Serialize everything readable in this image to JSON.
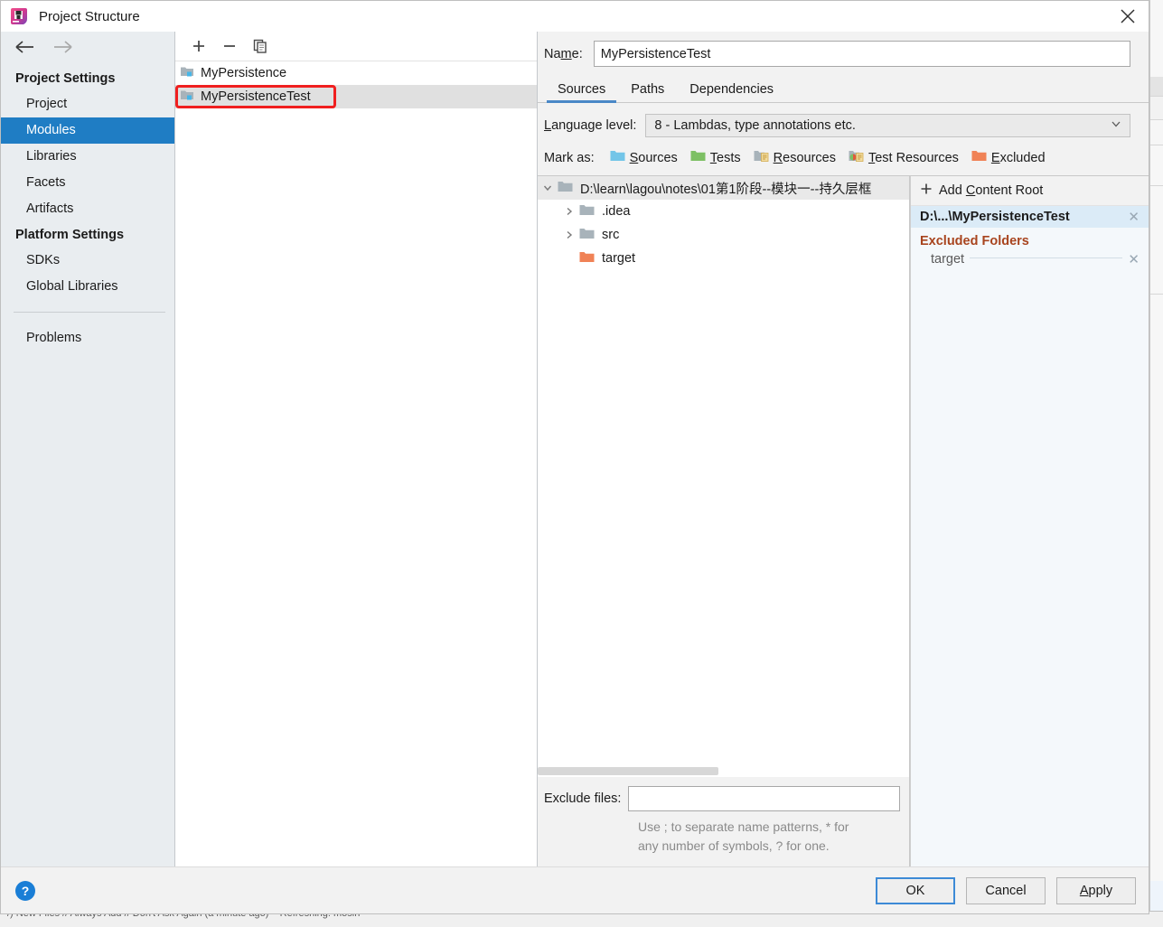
{
  "window": {
    "title": "Project Structure",
    "app_icon": "intellij-idea-logo",
    "close_icon": "close-icon"
  },
  "sidebar": {
    "back_icon": "back-arrow-icon",
    "forward_icon": "forward-arrow-icon",
    "groups": [
      {
        "title": "Project Settings",
        "items": [
          {
            "label": "Project",
            "selected": false
          },
          {
            "label": "Modules",
            "selected": true
          },
          {
            "label": "Libraries",
            "selected": false
          },
          {
            "label": "Facets",
            "selected": false
          },
          {
            "label": "Artifacts",
            "selected": false
          }
        ]
      },
      {
        "title": "Platform Settings",
        "items": [
          {
            "label": "SDKs",
            "selected": false
          },
          {
            "label": "Global Libraries",
            "selected": false
          }
        ]
      }
    ],
    "problems_label": "Problems"
  },
  "module_pane": {
    "toolbar": {
      "add_icon": "plus-icon",
      "remove_icon": "minus-icon",
      "copy_icon": "copy-icon"
    },
    "modules": [
      {
        "label": "MyPersistence",
        "selected": false,
        "highlighted": false
      },
      {
        "label": "MyPersistenceTest",
        "selected": true,
        "highlighted": true
      }
    ]
  },
  "content": {
    "name_label": "Name:",
    "name_label_pre": "Na",
    "name_label_mnemonic": "m",
    "name_label_post": "e:",
    "name_value": "MyPersistenceTest",
    "tabs": [
      {
        "label": "Sources",
        "active": true
      },
      {
        "label": "Paths",
        "active": false
      },
      {
        "label": "Dependencies",
        "active": false
      }
    ],
    "language_level": {
      "label_pre": "",
      "label_mnemonic": "L",
      "label_post": "anguage level:",
      "value": "8 - Lambdas, type annotations etc.",
      "chevron_icon": "chevron-down-icon"
    },
    "mark_as": {
      "label": "Mark as:",
      "options": [
        {
          "label_mnemonic": "S",
          "label_post": "ources",
          "icon": "folder-blue-icon",
          "color": "#73c5e8"
        },
        {
          "label_mnemonic": "T",
          "label_post": "ests",
          "icon": "folder-green-icon",
          "color": "#7dc064"
        },
        {
          "label_mnemonic": "R",
          "label_post": "esources",
          "icon": "folder-resources-icon",
          "color": "#a8b3ba"
        },
        {
          "label_mnemonic": "T",
          "label_post": "est Resources",
          "icon": "folder-test-resources-icon",
          "color": "#a8b3ba"
        },
        {
          "label_mnemonic": "E",
          "label_post": "xcluded",
          "icon": "folder-orange-icon",
          "color": "#f08256"
        }
      ]
    },
    "tree": {
      "root": {
        "label": "D:\\learn\\lagou\\notes\\01第1阶段--模块一--持久层框",
        "twisty": "chevron-down-icon",
        "folder_icon": "folder-gray-icon"
      },
      "children": [
        {
          "label": ".idea",
          "twisty": "chevron-right-icon",
          "folder_icon": "folder-gray-icon",
          "folder_color": "#a8b3ba"
        },
        {
          "label": "src",
          "twisty": "chevron-right-icon",
          "folder_icon": "folder-gray-icon",
          "folder_color": "#a8b3ba"
        },
        {
          "label": "target",
          "twisty": "",
          "folder_icon": "folder-orange-icon",
          "folder_color": "#f08256"
        }
      ]
    },
    "exclude_files": {
      "label": "Exclude files:",
      "value": "",
      "placeholder": "",
      "hint_line1": "Use ; to separate name patterns, * for",
      "hint_line2": "any number of symbols, ? for one."
    }
  },
  "roots_panel": {
    "add_content_root": {
      "plus_icon": "plus-icon",
      "label_pre": "Add ",
      "label_mnemonic": "C",
      "label_post": "ontent Root"
    },
    "content_root": {
      "path": "D:\\...\\MyPersistenceTest",
      "remove_icon": "close-icon"
    },
    "excluded_folders": {
      "title": "Excluded Folders",
      "title_color": "#a8441e",
      "items": [
        {
          "name": "target",
          "remove_icon": "close-icon"
        }
      ]
    }
  },
  "footer": {
    "help_icon": "help-icon",
    "buttons": [
      {
        "label": "OK",
        "default": true,
        "mnemonic": ""
      },
      {
        "label": "Cancel",
        "default": false,
        "mnemonic": ""
      },
      {
        "label_pre": "",
        "label": "Apply",
        "default": false,
        "mnemonic": "A"
      }
    ]
  },
  "colors": {
    "accent_selection": "#1f7dc4",
    "highlight_red": "#f01f1f",
    "excluded_orange": "#a8441e",
    "tab_underline": "#4a88c7",
    "help_blue": "#1a7ed6"
  }
}
